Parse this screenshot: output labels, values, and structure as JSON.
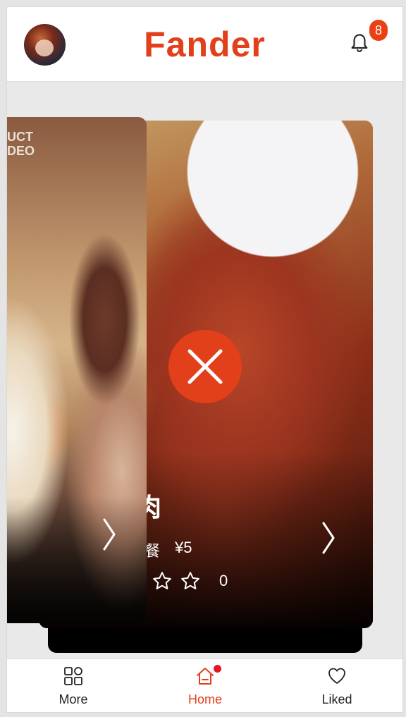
{
  "header": {
    "title": "Fander",
    "notification_count": "8"
  },
  "card": {
    "name_partial": "肉",
    "price_label_partial": "餐",
    "price": "¥5",
    "rating_count": "0",
    "stars_outline": 2
  },
  "tabs": [
    {
      "label": "More",
      "icon": "grid-icon",
      "active": false
    },
    {
      "label": "Home",
      "icon": "home-icon",
      "active": true,
      "dot": true
    },
    {
      "label": "Liked",
      "icon": "heart-icon",
      "active": false
    }
  ],
  "colors": {
    "brand": "#e2401a",
    "badge": "#e94015",
    "dot": "#e8152a"
  }
}
